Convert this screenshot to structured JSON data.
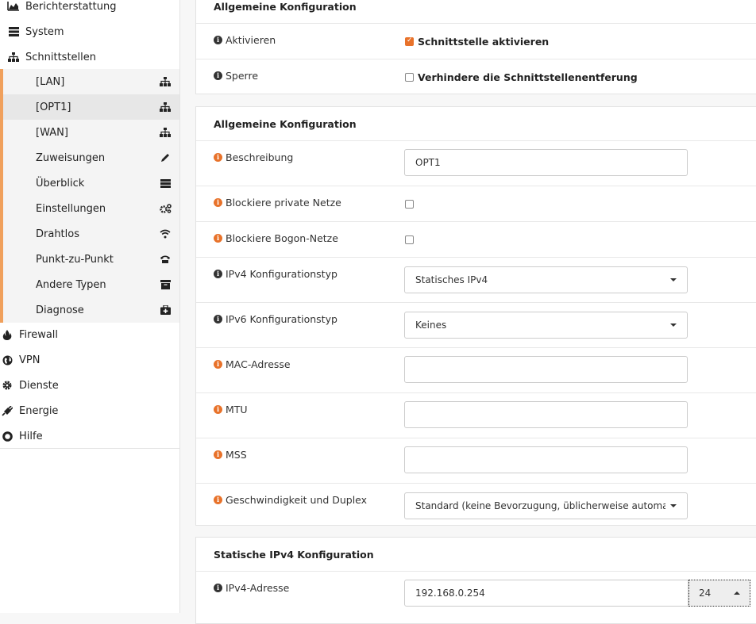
{
  "sidebar": {
    "top_items": [
      {
        "label": "Berichterstattung",
        "icon": "area-chart-icon"
      },
      {
        "label": "System",
        "icon": "server-icon"
      },
      {
        "label": "Schnittstellen",
        "icon": "sitemap-icon"
      }
    ],
    "sub_items": [
      {
        "label": "[LAN]",
        "icon": "sitemap-icon"
      },
      {
        "label": "[OPT1]",
        "icon": "sitemap-icon"
      },
      {
        "label": "[WAN]",
        "icon": "sitemap-icon"
      },
      {
        "label": "Zuweisungen",
        "icon": "pencil-icon"
      },
      {
        "label": "Überblick",
        "icon": "tasks-icon"
      },
      {
        "label": "Einstellungen",
        "icon": "cogs-icon"
      },
      {
        "label": "Drahtlos",
        "icon": "wifi-icon"
      },
      {
        "label": "Punkt-zu-Punkt",
        "icon": "phone-icon"
      },
      {
        "label": "Andere Typen",
        "icon": "archive-icon"
      },
      {
        "label": "Diagnose",
        "icon": "medkit-icon"
      }
    ],
    "bottom_items": [
      {
        "label": "Firewall",
        "icon": "fire-icon"
      },
      {
        "label": "VPN",
        "icon": "globe-icon"
      },
      {
        "label": "Dienste",
        "icon": "cog-icon"
      },
      {
        "label": "Energie",
        "icon": "plug-icon"
      },
      {
        "label": "Hilfe",
        "icon": "life-ring-icon"
      }
    ]
  },
  "card1": {
    "header": "Allgemeine Konfiguration",
    "aktivieren_label": "Aktivieren",
    "aktivieren_check": "Schnittstelle aktivieren",
    "sperre_label": "Sperre",
    "sperre_check": "Verhindere die Schnittstellenentferung"
  },
  "card2": {
    "header": "Allgemeine Konfiguration",
    "beschreibung_label": "Beschreibung",
    "beschreibung_value": "OPT1",
    "private_label": "Blockiere private Netze",
    "bogon_label": "Blockiere Bogon-Netze",
    "ipv4_type_label": "IPv4 Konfigurationstyp",
    "ipv4_type_value": "Statisches IPv4",
    "ipv6_type_label": "IPv6 Konfigurationstyp",
    "ipv6_type_value": "Keines",
    "mac_label": "MAC-Adresse",
    "mac_value": "",
    "mtu_label": "MTU",
    "mtu_value": "",
    "mss_label": "MSS",
    "mss_value": "",
    "speed_label": "Geschwindigkeit und Duplex",
    "speed_value": "Standard (keine Bevorzugung, üblicherweise automa"
  },
  "card3": {
    "header": "Statische IPv4 Konfiguration",
    "ipv4_label": "IPv4-Adresse",
    "ipv4_value": "192.168.0.254",
    "prefix_value": "24"
  },
  "colors": {
    "accent": "#e8722a",
    "sidebar_border": "#f0a05c"
  }
}
